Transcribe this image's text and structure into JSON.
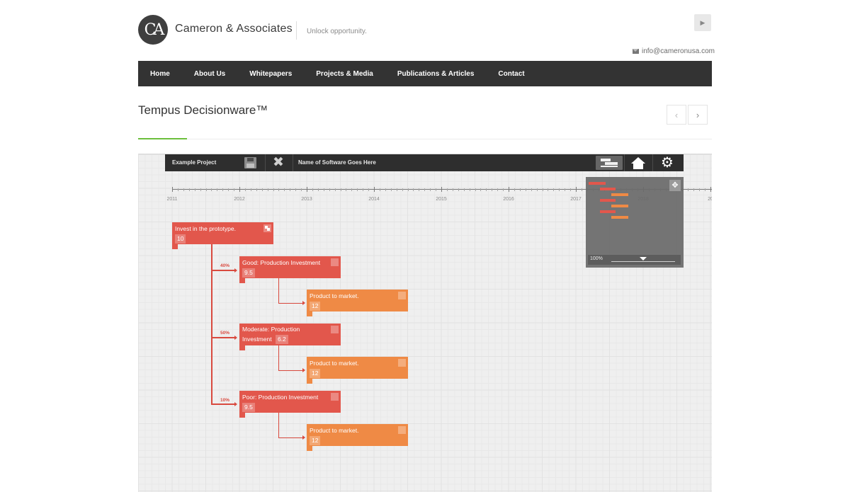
{
  "header": {
    "logo_glyph": "CA",
    "brand_name": "Cameron & Associates",
    "tagline": "Unlock opportunity.",
    "email": "info@cameronusa.com",
    "youtube_icon": "youtube-icon"
  },
  "nav": {
    "items": [
      {
        "label": "Home"
      },
      {
        "label": "About Us"
      },
      {
        "label": "Whitepapers"
      },
      {
        "label": "Projects & Media"
      },
      {
        "label": "Publications & Articles"
      },
      {
        "label": "Contact"
      }
    ]
  },
  "page": {
    "title": "Tempus Decisionware™",
    "prev_label": "‹",
    "next_label": "›",
    "accent_color": "#6cbf3c"
  },
  "app": {
    "toolbar": {
      "project_name": "Example Project",
      "software_name": "Name of Software Goes Here",
      "icons": [
        "save-icon",
        "close-icon",
        "gantt-view-icon",
        "home-icon",
        "gear-icon"
      ]
    },
    "timeline": {
      "years": [
        "2011",
        "2012",
        "2013",
        "2014",
        "2015",
        "2016",
        "2017",
        "2018",
        "20"
      ]
    },
    "minimap": {
      "zoom": "100%",
      "icons": [
        "move-icon",
        "chevron-down-icon"
      ]
    },
    "tree": {
      "root": {
        "title": "Invest in the prototype.",
        "value": "10"
      },
      "branches": [
        {
          "probability": "40%",
          "title": "Good: Production Investment",
          "value": "9.5",
          "child": {
            "title": "Product to market.",
            "value": "12"
          }
        },
        {
          "probability": "50%",
          "title_line1": "Moderate: Production",
          "title_line2": "Investment",
          "value": "6.2",
          "child": {
            "title": "Product to market.",
            "value": "12"
          }
        },
        {
          "probability": "10%",
          "title": "Poor: Production Investment",
          "value": "9.5",
          "child": {
            "title": "Product to market.",
            "value": "12"
          }
        }
      ]
    },
    "colors": {
      "decision_node": "#e2574c",
      "outcome_node": "#ef8a45",
      "connector": "#d94a3f",
      "toolbar": "#2e2e2e"
    }
  }
}
